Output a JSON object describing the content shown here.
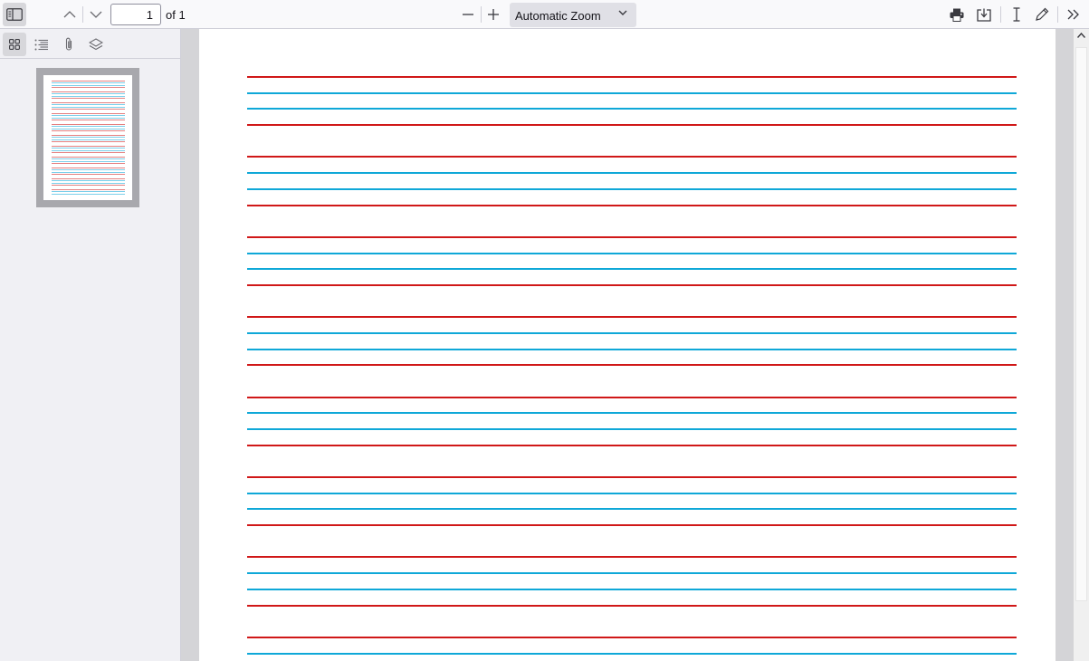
{
  "toolbar": {
    "page_number": "1",
    "page_count_label": "of 1",
    "zoom_label": "Automatic Zoom",
    "icons": [
      "sidebar-toggle-icon",
      "previous-page-icon",
      "next-page-icon",
      "zoom-out-icon",
      "zoom-in-icon",
      "print-icon",
      "save-icon",
      "text-selection-icon",
      "draw-icon",
      "tools-icon"
    ]
  },
  "sidebar": {
    "views": [
      "thumbnails",
      "outline",
      "attachments",
      "layers"
    ],
    "active_view": "thumbnails",
    "thumbnails": [
      {
        "page": 1,
        "selected": true
      }
    ]
  },
  "document": {
    "ruling_groups_visible": 8,
    "line_colors": {
      "guide_red": "#d01818",
      "guide_blue": "#0fa8d8"
    },
    "group_pattern": [
      "red",
      "blue",
      "blue",
      "red"
    ]
  }
}
